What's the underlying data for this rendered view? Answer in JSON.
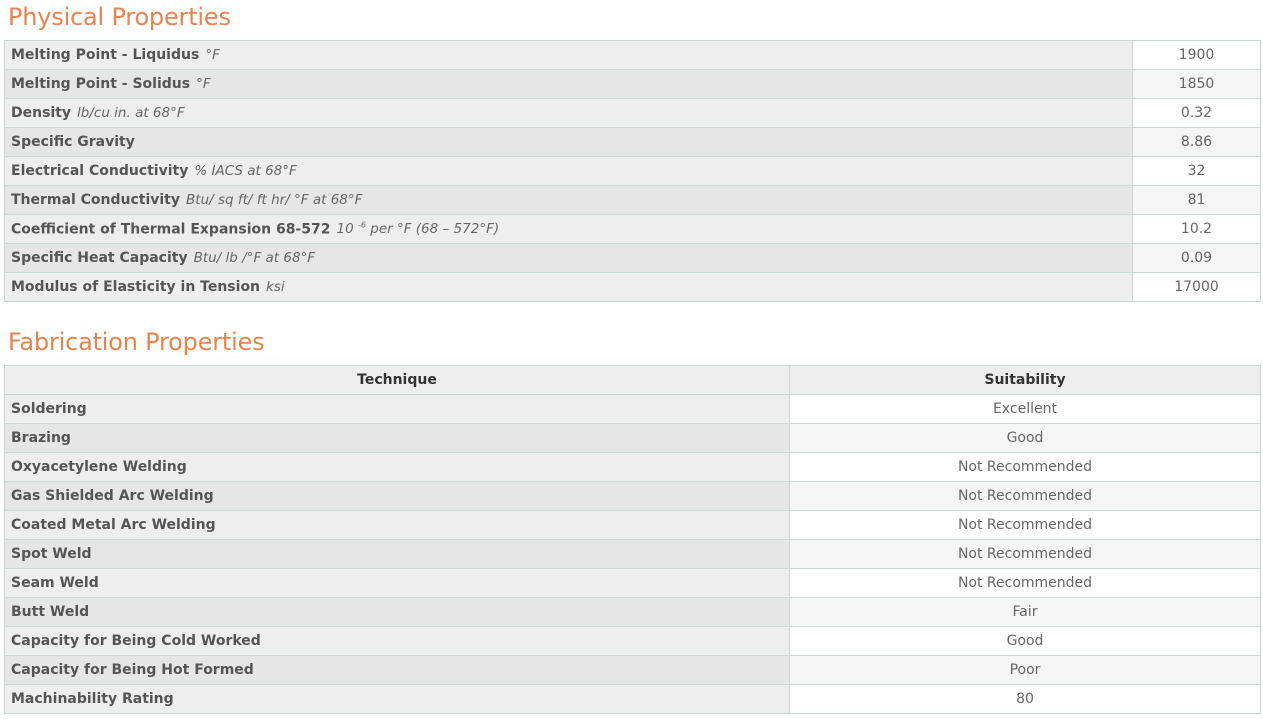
{
  "physical": {
    "title": "Physical Properties",
    "rows": [
      {
        "label": "Melting Point - Liquidus",
        "unit": "°F",
        "value": "1900"
      },
      {
        "label": "Melting Point - Solidus",
        "unit": "°F",
        "value": "1850"
      },
      {
        "label": "Density",
        "unit": "lb/cu in. at 68°F",
        "value": "0.32"
      },
      {
        "label": "Specific Gravity",
        "unit": "",
        "value": "8.86"
      },
      {
        "label": "Electrical Conductivity",
        "unit": "% IACS at 68°F",
        "value": "32"
      },
      {
        "label": "Thermal Conductivity",
        "unit": "Btu/ sq ft/ ft hr/ °F at 68°F",
        "value": "81"
      },
      {
        "label": "Coefficient of Thermal Expansion 68-572",
        "unit_pre": "10",
        "unit_sup": "-6",
        "unit": "per °F (68 – 572°F)",
        "value": "10.2"
      },
      {
        "label": "Specific Heat Capacity",
        "unit": "Btu/ lb /°F at 68°F",
        "value": "0.09"
      },
      {
        "label": "Modulus of Elasticity in Tension",
        "unit": "ksi",
        "value": "17000"
      }
    ]
  },
  "fabrication": {
    "title": "Fabrication Properties",
    "headers": {
      "technique": "Technique",
      "suitability": "Suitability"
    },
    "rows": [
      {
        "label": "Soldering",
        "value": "Excellent"
      },
      {
        "label": "Brazing",
        "value": "Good"
      },
      {
        "label": "Oxyacetylene Welding",
        "value": "Not Recommended"
      },
      {
        "label": "Gas Shielded Arc Welding",
        "value": "Not Recommended"
      },
      {
        "label": "Coated Metal Arc Welding",
        "value": "Not Recommended"
      },
      {
        "label": "Spot Weld",
        "value": "Not Recommended"
      },
      {
        "label": "Seam Weld",
        "value": "Not Recommended"
      },
      {
        "label": "Butt Weld",
        "value": "Fair"
      },
      {
        "label": "Capacity for Being Cold Worked",
        "value": "Good"
      },
      {
        "label": "Capacity for Being Hot Formed",
        "value": "Poor"
      },
      {
        "label": "Machinability Rating",
        "value": "80"
      }
    ]
  }
}
